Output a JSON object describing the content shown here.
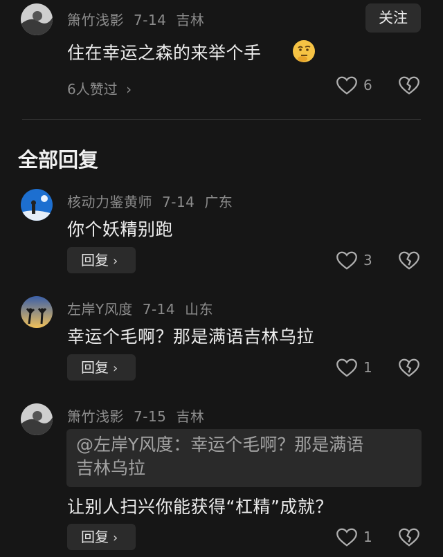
{
  "top_comment": {
    "user": "箫竹浅影",
    "date": "7-14",
    "location": "吉林",
    "follow_label": "关注",
    "text": "住在幸运之森的来举个手",
    "emoji_icon": "thinking-face-emoji",
    "liked_by": "6人赞过",
    "like_count": "6"
  },
  "section_title": "全部回复",
  "replies": [
    {
      "user": "核动力鉴黄师",
      "date": "7-14",
      "location": "广东",
      "text": "你个妖精别跑",
      "reply_label": "回复",
      "like_count": "3"
    },
    {
      "user": "左岸Y风度",
      "date": "7-14",
      "location": "山东",
      "text": "幸运个毛啊？那是满语吉林乌拉",
      "reply_label": "回复",
      "like_count": "1"
    },
    {
      "user": "箫竹浅影",
      "date": "7-15",
      "location": "吉林",
      "quote_line1": "@左岸Y风度：幸运个毛啊？那是满语",
      "quote_line2": "吉林乌拉",
      "text": "让别人扫兴你能获得“杠精”成就？",
      "reply_label": "回复",
      "like_count": "1"
    }
  ],
  "colors": {
    "background": "#161616",
    "button_bg": "#2c2c2c",
    "meta_text": "#8c8c8c",
    "body_text": "#ececec"
  }
}
